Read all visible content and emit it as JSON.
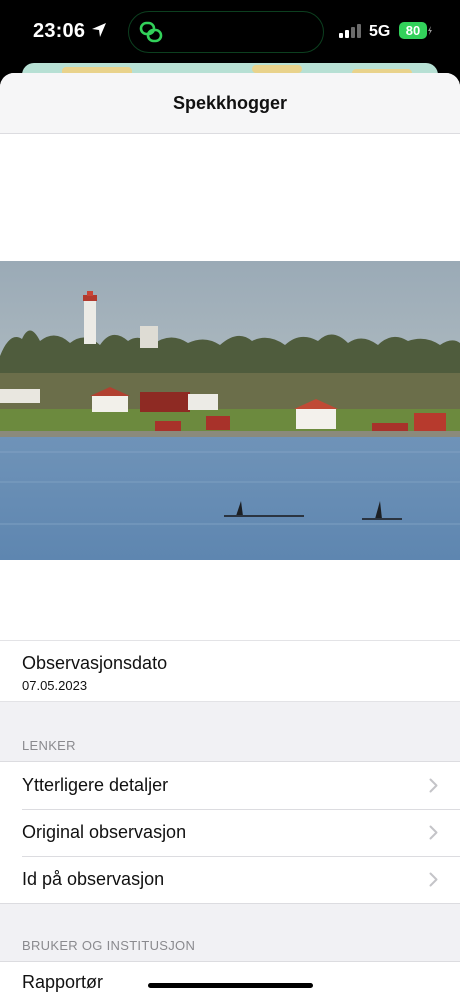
{
  "status_bar": {
    "time": "23:06",
    "network": "5G",
    "battery": "80",
    "icons": [
      "location-arrow-icon",
      "app-activity-icon",
      "signal-bars-icon",
      "battery-charging-icon"
    ]
  },
  "sheet": {
    "title": "Spekkhogger",
    "photo": {
      "description_icon": "observation-photo"
    },
    "date": {
      "label": "Observasjonsdato",
      "value": "07.05.2023"
    },
    "links_section": {
      "header": "LENKER",
      "items": [
        {
          "label": "Ytterligere detaljer"
        },
        {
          "label": "Original observasjon"
        },
        {
          "label": "Id på observasjon"
        }
      ]
    },
    "user_section": {
      "header": "BRUKER OG INSTITUSJON",
      "items": [
        {
          "label": "Rapportør"
        }
      ]
    }
  },
  "colors": {
    "accent_green": "#32d15a",
    "separator": "#dcdce0",
    "group_background": "#f1f1f4",
    "chevron": "#c4c4c8"
  }
}
